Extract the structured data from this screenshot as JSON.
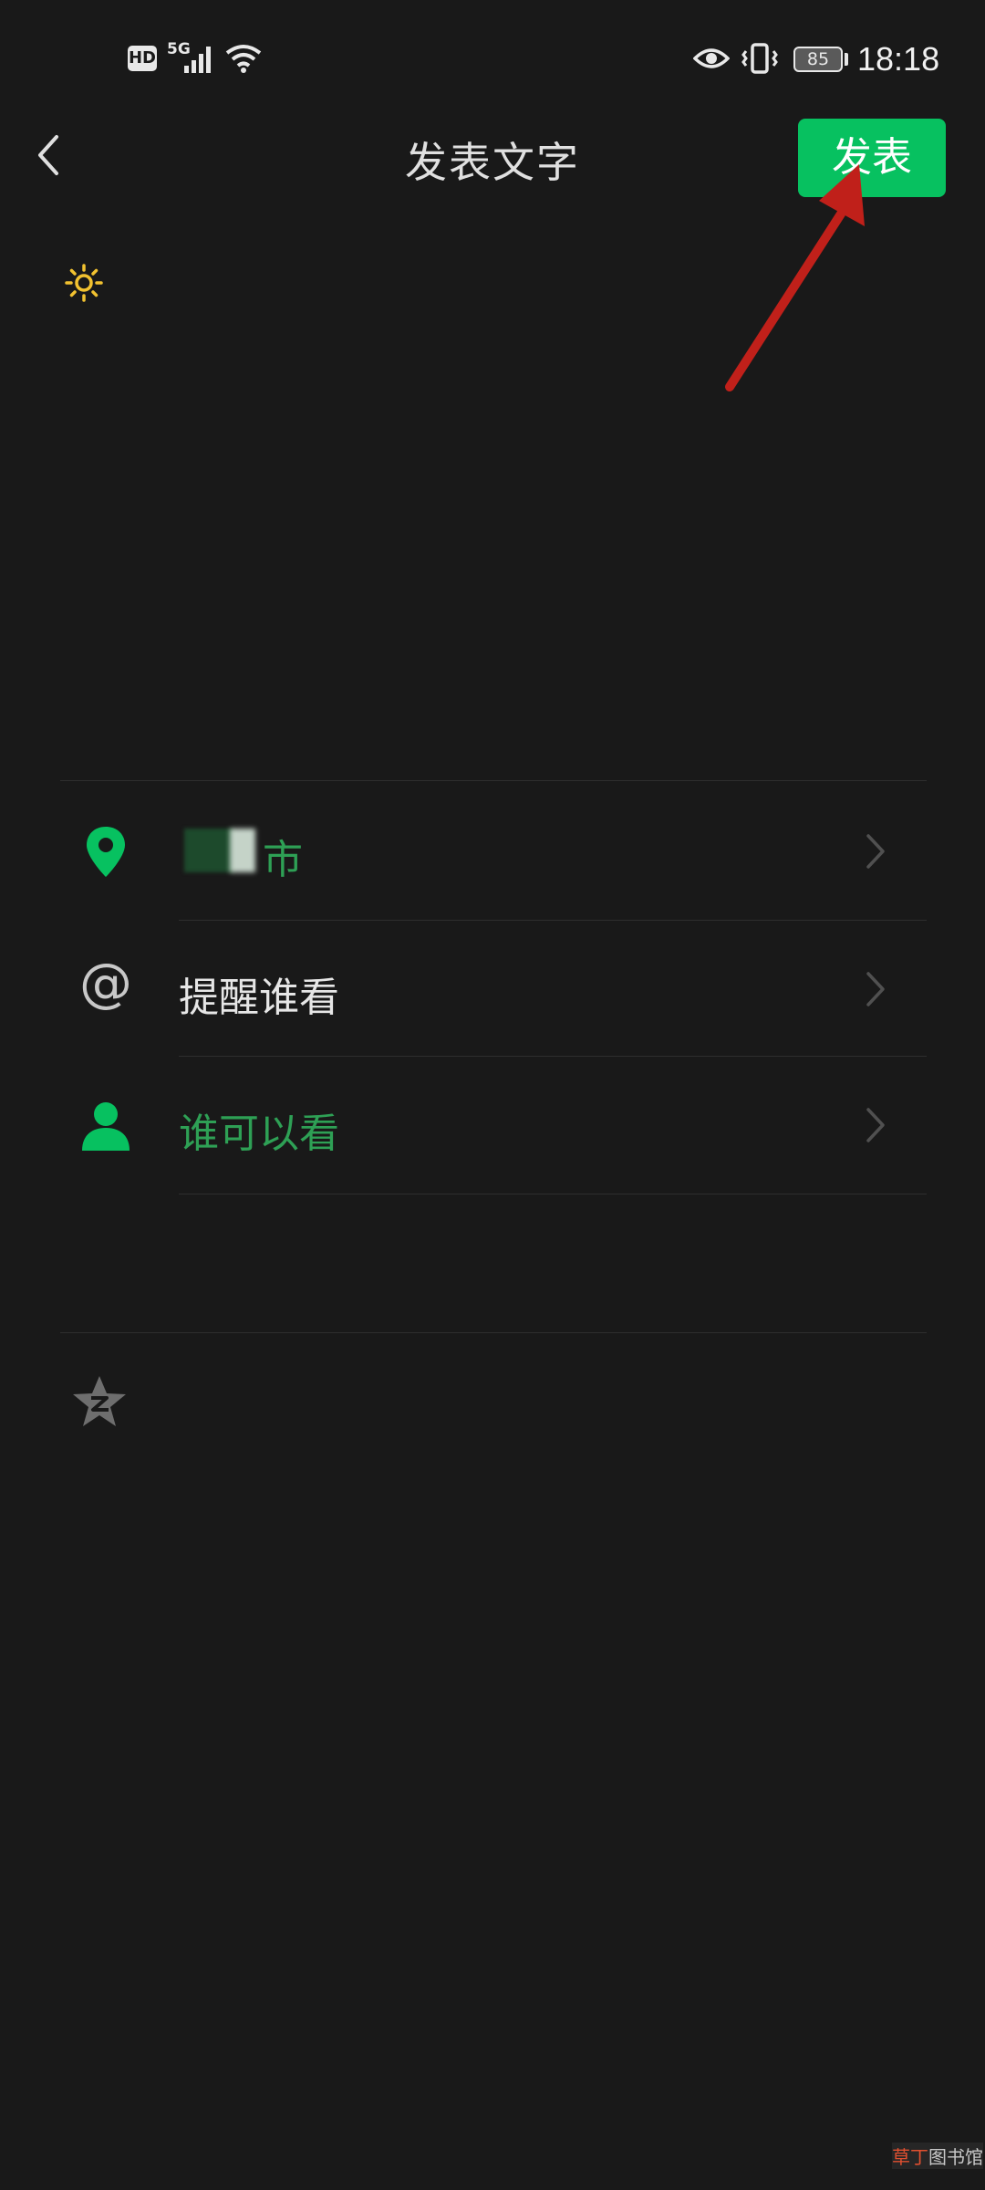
{
  "status_bar": {
    "hd": "HD",
    "network": "5G",
    "battery": "85",
    "time": "18:18"
  },
  "header": {
    "title": "发表文字",
    "publish_label": "发表"
  },
  "options": {
    "location": {
      "label": "市",
      "icon": "location-pin-icon"
    },
    "mention": {
      "icon_glyph": "@",
      "label": "提醒谁看"
    },
    "visibility": {
      "label": "谁可以看",
      "icon": "person-icon"
    }
  },
  "colors": {
    "background": "#191919",
    "accent_green": "#07c160",
    "green_text": "#2ea055",
    "annotation_arrow": "#c0201a"
  },
  "watermark": {
    "part1": "草丁",
    "part2": "图书馆"
  }
}
